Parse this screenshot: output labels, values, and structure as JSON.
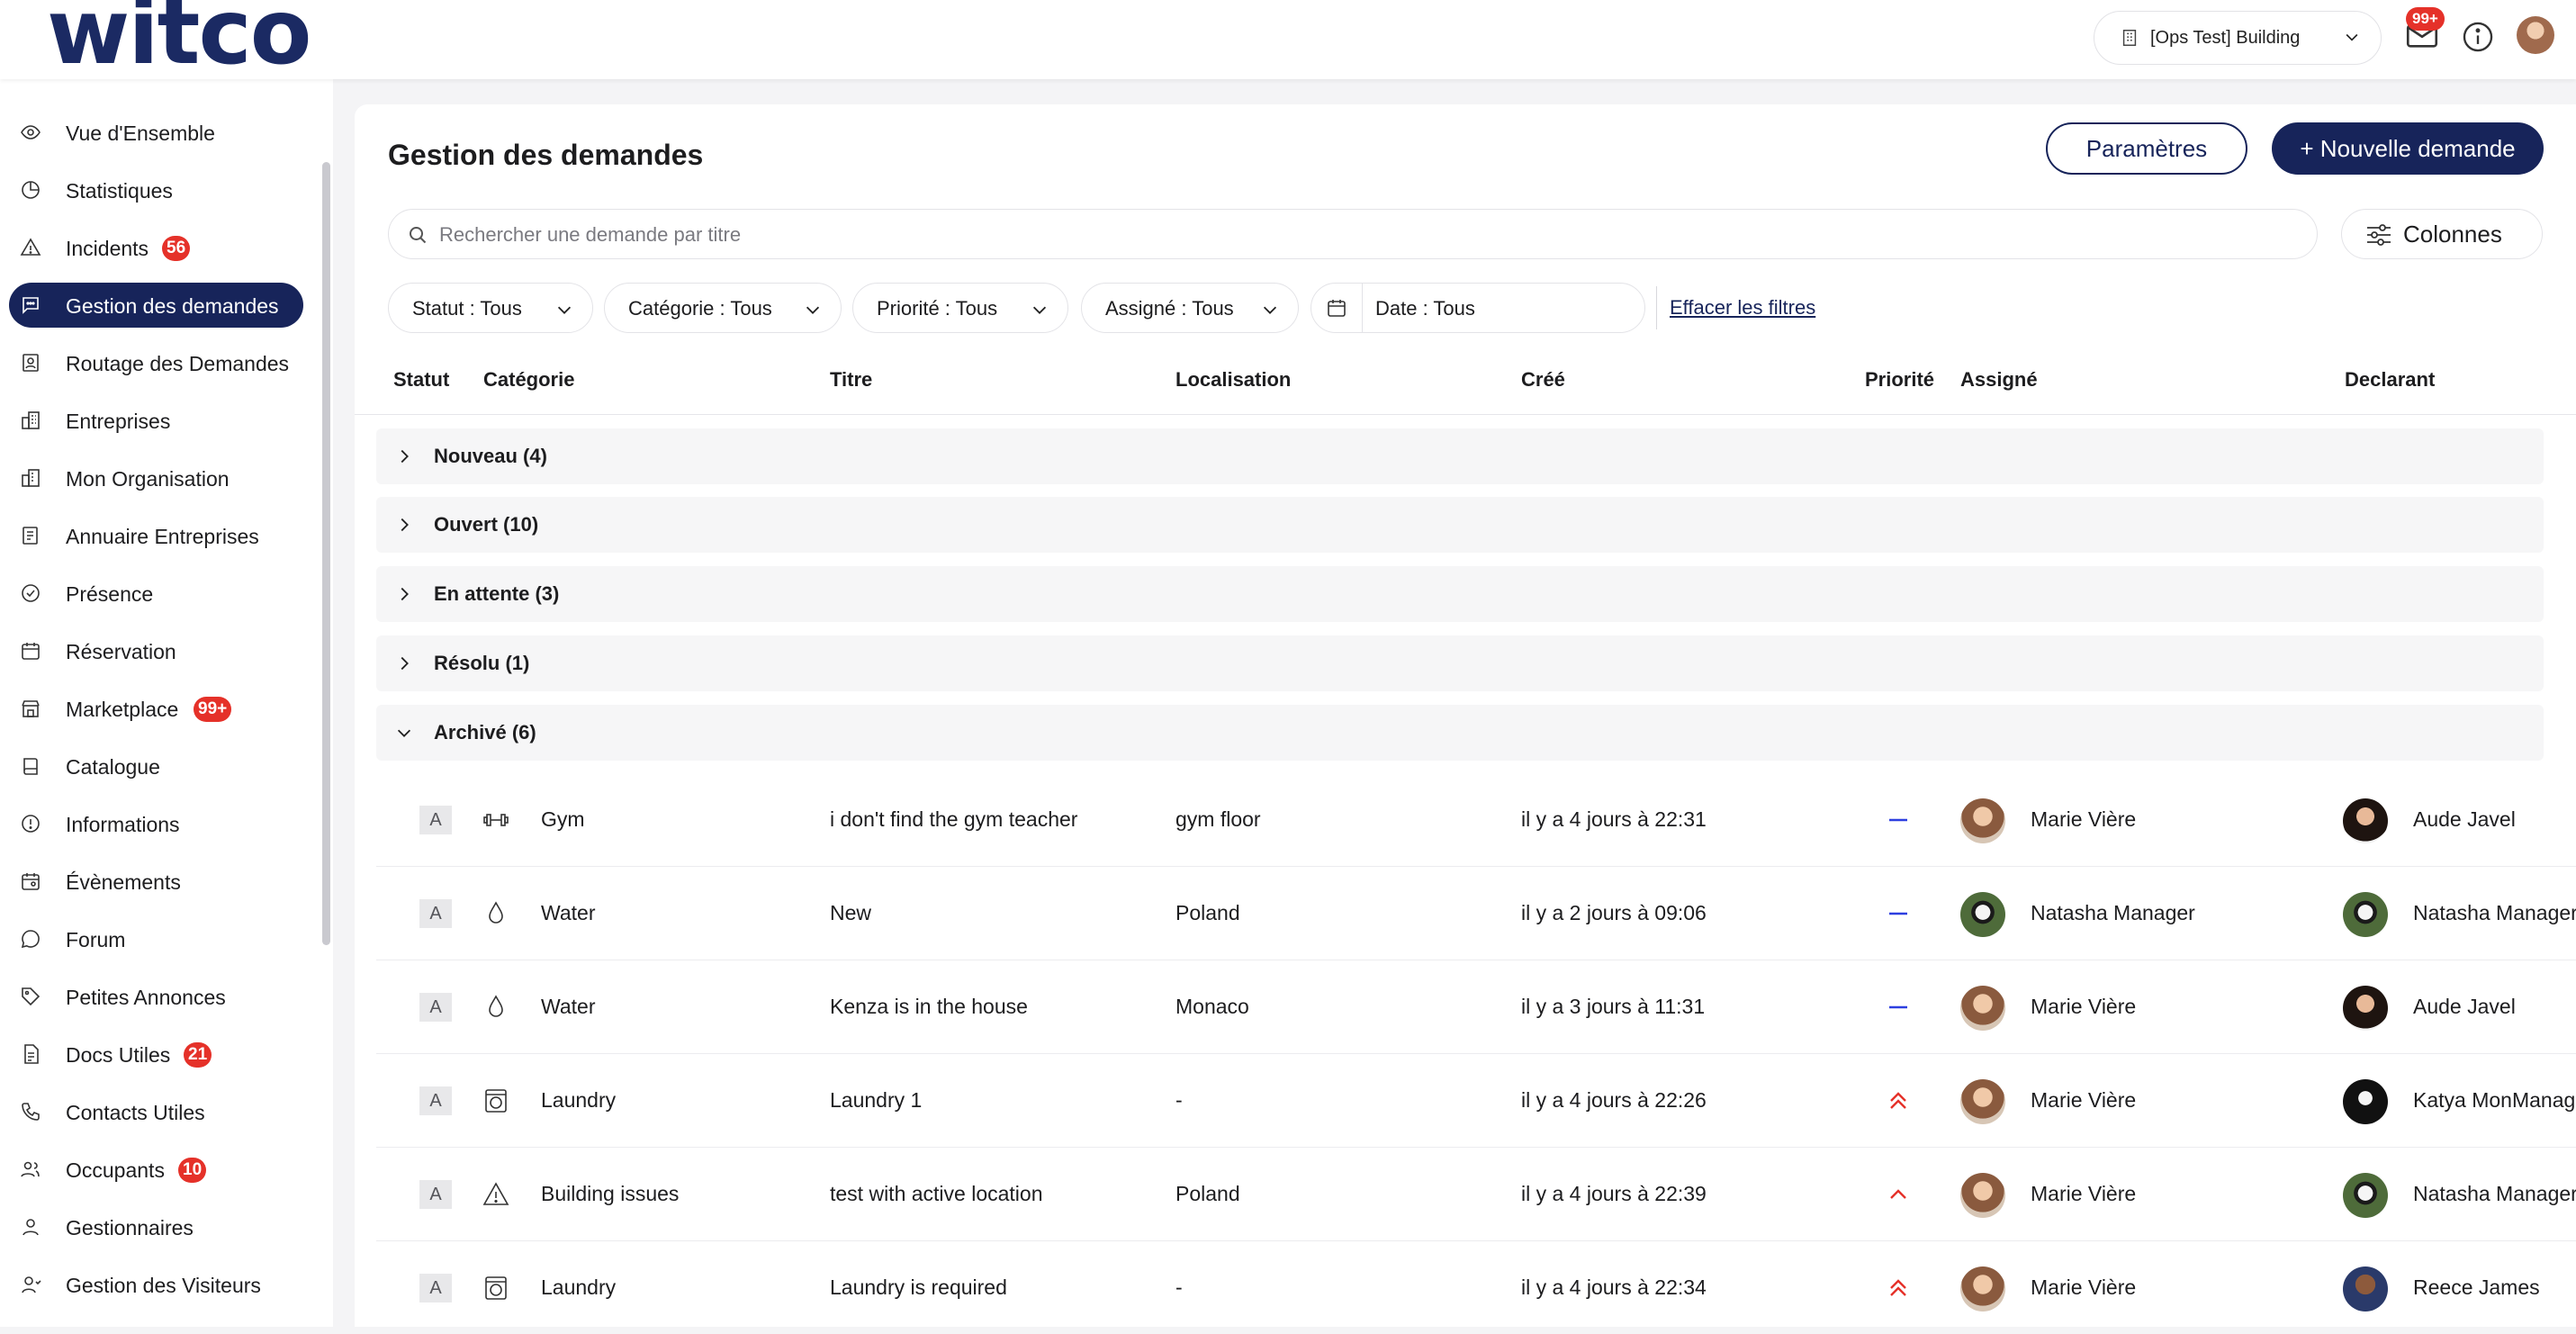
{
  "app": {
    "logo": "witco",
    "building_selector": "[Ops Test] Building",
    "mail_badge": "99+"
  },
  "sidebar": {
    "items": [
      {
        "label": "Vue d'Ensemble",
        "icon": "eye-icon"
      },
      {
        "label": "Statistiques",
        "icon": "pie-chart-icon"
      },
      {
        "label": "Incidents",
        "icon": "warning-icon",
        "badge": "56"
      },
      {
        "label": "Gestion des demandes",
        "icon": "chat-icon",
        "active": true
      },
      {
        "label": "Routage des Demandes",
        "icon": "routing-icon"
      },
      {
        "label": "Entreprises",
        "icon": "buildings-icon"
      },
      {
        "label": "Mon Organisation",
        "icon": "organisation-icon"
      },
      {
        "label": "Annuaire Entreprises",
        "icon": "directory-icon"
      },
      {
        "label": "Présence",
        "icon": "check-circle-icon"
      },
      {
        "label": "Réservation",
        "icon": "calendar-icon"
      },
      {
        "label": "Marketplace",
        "icon": "store-icon",
        "badge": "99+"
      },
      {
        "label": "Catalogue",
        "icon": "book-icon"
      },
      {
        "label": "Informations",
        "icon": "info-icon"
      },
      {
        "label": "Évènements",
        "icon": "event-icon"
      },
      {
        "label": "Forum",
        "icon": "speech-bubble-icon"
      },
      {
        "label": "Petites Annonces",
        "icon": "tag-icon"
      },
      {
        "label": "Docs Utiles",
        "icon": "document-icon",
        "badge": "21"
      },
      {
        "label": "Contacts Utiles",
        "icon": "phone-icon"
      },
      {
        "label": "Occupants",
        "icon": "users-icon",
        "badge": "10"
      },
      {
        "label": "Gestionnaires",
        "icon": "user-icon"
      },
      {
        "label": "Gestion des Visiteurs",
        "icon": "visitor-icon"
      }
    ]
  },
  "header": {
    "title": "Gestion des demandes",
    "params_button": "Paramètres",
    "new_button": "+ Nouvelle demande"
  },
  "search": {
    "placeholder": "Rechercher une demande par titre",
    "columns_button": "Colonnes"
  },
  "filters": {
    "statut": "Statut : Tous",
    "categorie": "Catégorie : Tous",
    "priorite": "Priorité : Tous",
    "assigne": "Assigné : Tous",
    "date": "Date : Tous",
    "clear": "Effacer les filtres"
  },
  "table": {
    "columns": [
      "Statut",
      "Catégorie",
      "Titre",
      "Localisation",
      "Créé",
      "Priorité",
      "Assigné",
      "Declarant"
    ],
    "groups": [
      {
        "label": "Nouveau (4)",
        "expanded": false
      },
      {
        "label": "Ouvert (10)",
        "expanded": false
      },
      {
        "label": "En attente (3)",
        "expanded": false
      },
      {
        "label": "Résolu (1)",
        "expanded": false
      },
      {
        "label": "Archivé (6)",
        "expanded": true
      }
    ],
    "rows": [
      {
        "status": "A",
        "category": "Gym",
        "category_icon": "dumbbell-icon",
        "title": "i don't find the gym teacher",
        "location": "gym floor",
        "created": "il y a 4 jours à 22:31",
        "priority": "medium",
        "assignee": "Marie Vière",
        "declarant": "Aude Javel"
      },
      {
        "status": "A",
        "category": "Water",
        "category_icon": "water-drop-icon",
        "title": "New",
        "location": "Poland",
        "created": "il y a 2 jours à 09:06",
        "priority": "medium",
        "assignee": "Natasha Manager",
        "declarant": "Natasha Manager"
      },
      {
        "status": "A",
        "category": "Water",
        "category_icon": "water-drop-icon",
        "title": "Kenza is in the house",
        "location": "Monaco",
        "created": "il y a 3 jours à 11:31",
        "priority": "medium",
        "assignee": "Marie Vière",
        "declarant": "Aude Javel"
      },
      {
        "status": "A",
        "category": "Laundry",
        "category_icon": "washing-machine-icon",
        "title": "Laundry 1",
        "location": "-",
        "created": "il y a 4 jours à 22:26",
        "priority": "urgent",
        "assignee": "Marie Vière",
        "declarant": "Katya MonManager"
      },
      {
        "status": "A",
        "category": "Building issues",
        "category_icon": "warning-icon",
        "title": "test with active location",
        "location": "Poland",
        "created": "il y a 4 jours à 22:39",
        "priority": "high",
        "assignee": "Marie Vière",
        "declarant": "Natasha Manager"
      },
      {
        "status": "A",
        "category": "Laundry",
        "category_icon": "washing-machine-icon",
        "title": "Laundry is required",
        "location": "-",
        "created": "il y a 4 jours à 22:34",
        "priority": "urgent",
        "assignee": "Marie Vière",
        "declarant": "Reece James"
      }
    ]
  },
  "colors": {
    "brand_navy": "#17245a",
    "badge_red": "#e53129",
    "priority_medium": "#2d3fe0",
    "priority_high": "#e53129"
  }
}
